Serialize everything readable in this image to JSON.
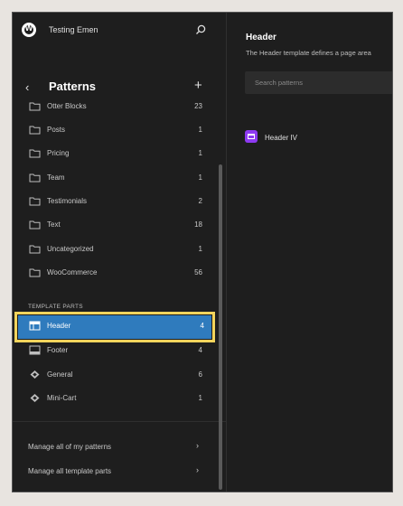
{
  "site": {
    "title": "Testing Emen"
  },
  "sidebar": {
    "title": "Patterns",
    "categories": [
      {
        "label": "Otter Blocks",
        "count": "23"
      },
      {
        "label": "Posts",
        "count": "1"
      },
      {
        "label": "Pricing",
        "count": "1"
      },
      {
        "label": "Team",
        "count": "1"
      },
      {
        "label": "Testimonials",
        "count": "2"
      },
      {
        "label": "Text",
        "count": "18"
      },
      {
        "label": "Uncategorized",
        "count": "1"
      },
      {
        "label": "WooCommerce",
        "count": "56"
      }
    ],
    "section_label": "TEMPLATE PARTS",
    "template_parts": [
      {
        "label": "Header",
        "count": "4",
        "icon": "header-icon",
        "selected": true
      },
      {
        "label": "Footer",
        "count": "4",
        "icon": "footer-icon"
      },
      {
        "label": "General",
        "count": "6",
        "icon": "symbol-icon"
      },
      {
        "label": "Mini-Cart",
        "count": "1",
        "icon": "symbol-icon"
      }
    ],
    "links": [
      {
        "label": "Manage all of my patterns"
      },
      {
        "label": "Manage all template parts"
      }
    ]
  },
  "main": {
    "title": "Header",
    "description": "The Header template defines a page area",
    "search_placeholder": "Search patterns",
    "items": [
      {
        "label": "Header IV"
      }
    ]
  },
  "colors": {
    "highlight": "#2f7bbd",
    "outline": "#f2d45c",
    "pattern_icon": "#8e3af2"
  }
}
